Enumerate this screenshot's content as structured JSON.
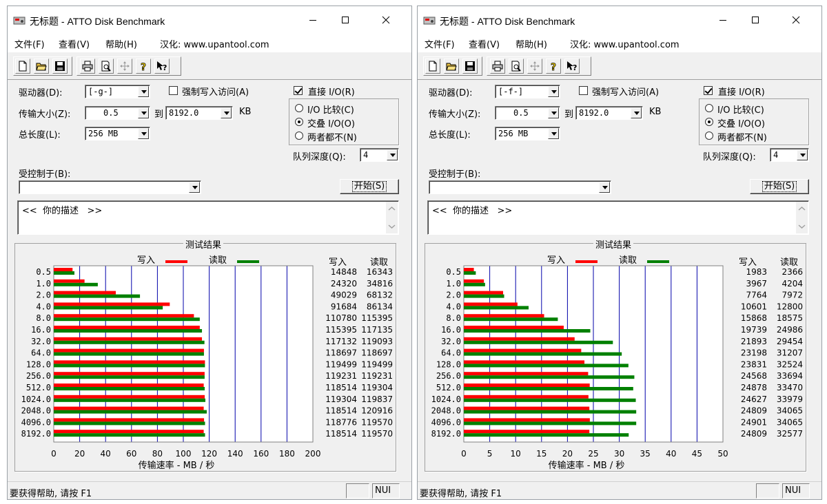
{
  "windows": [
    {
      "title": "无标题 - ATTO Disk Benchmark",
      "menu": [
        "文件(F)",
        "查看(V)",
        "帮助(H)",
        "汉化: www.upantool.com"
      ],
      "drive_label": "驱动器(D):",
      "drive_value": "[-g-]",
      "force_write_label": "强制写入访问(A)",
      "direct_io_label": "直接 I/O(R)",
      "transfer_label": "传输大小(Z):",
      "transfer_from": "0.5",
      "to_label": "到",
      "transfer_to": "8192.0",
      "kb_label": "KB",
      "total_label": "总长度(L):",
      "total_value": "256 MB",
      "io_compare_label": "I/O 比较(C)",
      "overlap_label": "交叠 I/O(O)",
      "neither_label": "两者都不(N)",
      "queue_label": "队列深度(Q):",
      "queue_value": "4",
      "controlled_label": "受控制于(B):",
      "controlled_value": "",
      "start_label": "开始(S)",
      "description": "<<  你的描述   >>",
      "results_title": "测试结果",
      "legend_write": "写入",
      "legend_read": "读取",
      "col_write": "写入",
      "col_read": "读取",
      "status_text": "要获得帮助, 请按 F1",
      "status_num": "NUI"
    },
    {
      "title": "无标题 - ATTO Disk Benchmark",
      "menu": [
        "文件(F)",
        "查看(V)",
        "帮助(H)",
        "汉化: www.upantool.com"
      ],
      "drive_label": "驱动器(D):",
      "drive_value": "[-f-]",
      "force_write_label": "强制写入访问(A)",
      "direct_io_label": "直接 I/O(R)",
      "transfer_label": "传输大小(Z):",
      "transfer_from": "0.5",
      "to_label": "到",
      "transfer_to": "8192.0",
      "kb_label": "KB",
      "total_label": "总长度(L):",
      "total_value": "256 MB",
      "io_compare_label": "I/O 比较(C)",
      "overlap_label": "交叠 I/O(O)",
      "neither_label": "两者都不(N)",
      "queue_label": "队列深度(Q):",
      "queue_value": "4",
      "controlled_label": "受控制于(B):",
      "controlled_value": "",
      "start_label": "开始(S)",
      "description": "<<  你的描述   >>",
      "results_title": "测试结果",
      "legend_write": "写入",
      "legend_read": "读取",
      "col_write": "写入",
      "col_read": "读取",
      "status_text": "要获得帮助, 请按 F1",
      "status_num": "NUI"
    }
  ],
  "colors": {
    "write": "#ff0000",
    "read": "#008000",
    "grid": "#0000aa"
  },
  "chart_data": [
    {
      "type": "bar",
      "orientation": "horizontal",
      "categories": [
        "0.5",
        "1.0",
        "2.0",
        "4.0",
        "8.0",
        "16.0",
        "32.0",
        "64.0",
        "128.0",
        "256.0",
        "512.0",
        "1024.0",
        "2048.0",
        "4096.0",
        "8192.0"
      ],
      "series": [
        {
          "name": "写入",
          "values": [
            14848,
            24320,
            49029,
            91684,
            110780,
            115395,
            117132,
            118697,
            119499,
            119231,
            118514,
            119304,
            118514,
            118776,
            118514
          ]
        },
        {
          "name": "读取",
          "values": [
            16343,
            34816,
            68132,
            86134,
            115395,
            117135,
            119093,
            118697,
            119499,
            119231,
            119304,
            119837,
            120916,
            119570,
            119570
          ]
        }
      ],
      "xlabel": "传输速率 - MB / 秒",
      "xlim": [
        0,
        200
      ],
      "xticks": [
        0,
        20,
        40,
        60,
        80,
        100,
        120,
        140,
        160,
        180,
        200
      ],
      "grid": true
    },
    {
      "type": "bar",
      "orientation": "horizontal",
      "categories": [
        "0.5",
        "1.0",
        "2.0",
        "4.0",
        "8.0",
        "16.0",
        "32.0",
        "64.0",
        "128.0",
        "256.0",
        "512.0",
        "1024.0",
        "2048.0",
        "4096.0",
        "8192.0"
      ],
      "series": [
        {
          "name": "写入",
          "values": [
            1983,
            3967,
            7764,
            10601,
            15868,
            19739,
            21893,
            23198,
            23831,
            24568,
            24878,
            24627,
            24809,
            24901,
            24809
          ]
        },
        {
          "name": "读取",
          "values": [
            2366,
            4204,
            7972,
            12800,
            18575,
            24986,
            29454,
            31207,
            32524,
            33694,
            33470,
            33979,
            34065,
            34065,
            32577
          ]
        }
      ],
      "xlabel": "传输速率 - MB / 秒",
      "xlim": [
        0,
        50
      ],
      "xticks": [
        0,
        5,
        10,
        15,
        20,
        25,
        30,
        35,
        40,
        45,
        50
      ],
      "grid": true
    }
  ]
}
